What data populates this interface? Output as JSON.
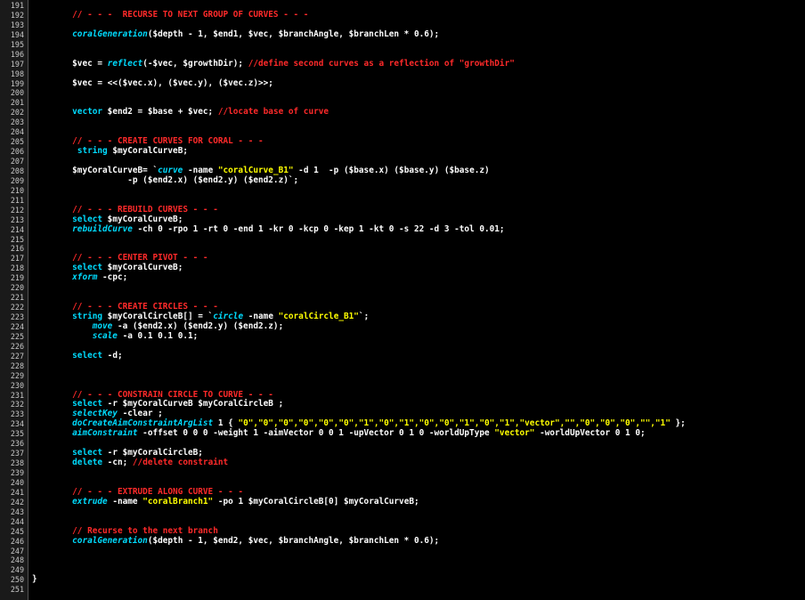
{
  "colors": {
    "background": "#000000",
    "gutter": "#1a1a1a",
    "line_number": "#c8c8c8",
    "default_text": "#ffffff",
    "comment": "#ff2a2a",
    "keyword": "#00dcff",
    "string": "#ffff00"
  },
  "editor": {
    "lines": [
      {
        "number": "191",
        "tokens": []
      },
      {
        "number": "192",
        "tokens": [
          {
            "t": "        "
          },
          {
            "c": "comment",
            "t": "// - - -  RECURSE TO NEXT GROUP OF CURVES - - -"
          }
        ]
      },
      {
        "number": "193",
        "tokens": []
      },
      {
        "number": "194",
        "tokens": [
          {
            "t": "        "
          },
          {
            "c": "func",
            "t": "coralGeneration"
          },
          {
            "t": "($depth - 1, $end1, $vec, $branchAngle, $branchLen * 0.6);"
          }
        ]
      },
      {
        "number": "195",
        "tokens": []
      },
      {
        "number": "196",
        "tokens": []
      },
      {
        "number": "197",
        "tokens": [
          {
            "t": "        $vec = "
          },
          {
            "c": "func",
            "t": "reflect"
          },
          {
            "t": "(-$vec, $growthDir); "
          },
          {
            "c": "comment",
            "t": "//define second curves as a reflection of \"growthDir\""
          }
        ]
      },
      {
        "number": "198",
        "tokens": []
      },
      {
        "number": "199",
        "tokens": [
          {
            "t": "        $vec = <<($vec.x), ($vec.y), ($vec.z)>>;"
          }
        ]
      },
      {
        "number": "200",
        "tokens": []
      },
      {
        "number": "201",
        "tokens": []
      },
      {
        "number": "202",
        "tokens": [
          {
            "t": "        "
          },
          {
            "c": "keyword",
            "t": "vector"
          },
          {
            "t": " $end2 = $base + $vec; "
          },
          {
            "c": "comment",
            "t": "//locate base of curve"
          }
        ]
      },
      {
        "number": "203",
        "tokens": []
      },
      {
        "number": "204",
        "tokens": []
      },
      {
        "number": "205",
        "tokens": [
          {
            "t": "        "
          },
          {
            "c": "comment",
            "t": "// - - - CREATE CURVES FOR CORAL - - -"
          }
        ]
      },
      {
        "number": "206",
        "tokens": [
          {
            "t": "         "
          },
          {
            "c": "keyword",
            "t": "string"
          },
          {
            "t": " $myCoralCurveB;"
          }
        ]
      },
      {
        "number": "207",
        "tokens": []
      },
      {
        "number": "208",
        "tokens": [
          {
            "t": "        $myCoralCurveB= `"
          },
          {
            "c": "func",
            "t": "curve"
          },
          {
            "t": " -name "
          },
          {
            "c": "string",
            "t": "\"coralCurve_B1\""
          },
          {
            "t": " -d 1  -p ($base.x) ($base.y) ($base.z)"
          }
        ]
      },
      {
        "number": "209",
        "tokens": [
          {
            "t": "                   -p ($end2.x) ($end2.y) ($end2.z)`;"
          }
        ]
      },
      {
        "number": "210",
        "tokens": []
      },
      {
        "number": "211",
        "tokens": []
      },
      {
        "number": "212",
        "tokens": [
          {
            "t": "        "
          },
          {
            "c": "comment",
            "t": "// - - - REBUILD CURVES - - -"
          }
        ]
      },
      {
        "number": "213",
        "tokens": [
          {
            "t": "        "
          },
          {
            "c": "keyword",
            "t": "select"
          },
          {
            "t": " $myCoralCurveB;"
          }
        ]
      },
      {
        "number": "214",
        "tokens": [
          {
            "t": "        "
          },
          {
            "c": "func",
            "t": "rebuildCurve"
          },
          {
            "t": " -ch 0 -rpo 1 -rt 0 -end 1 -kr 0 -kcp 0 -kep 1 -kt 0 -s 22 -d 3 -tol 0.01;"
          }
        ]
      },
      {
        "number": "215",
        "tokens": []
      },
      {
        "number": "216",
        "tokens": []
      },
      {
        "number": "217",
        "tokens": [
          {
            "t": "        "
          },
          {
            "c": "comment",
            "t": "// - - - CENTER PIVOT - - -"
          }
        ]
      },
      {
        "number": "218",
        "tokens": [
          {
            "t": "        "
          },
          {
            "c": "keyword",
            "t": "select"
          },
          {
            "t": " $myCoralCurveB;"
          }
        ]
      },
      {
        "number": "219",
        "tokens": [
          {
            "t": "        "
          },
          {
            "c": "func",
            "t": "xform"
          },
          {
            "t": " -cpc;"
          }
        ]
      },
      {
        "number": "220",
        "tokens": []
      },
      {
        "number": "221",
        "tokens": []
      },
      {
        "number": "222",
        "tokens": [
          {
            "t": "        "
          },
          {
            "c": "comment",
            "t": "// - - - CREATE CIRCLES - - -"
          }
        ]
      },
      {
        "number": "223",
        "tokens": [
          {
            "t": "        "
          },
          {
            "c": "keyword",
            "t": "string"
          },
          {
            "t": " $myCoralCircleB[] = `"
          },
          {
            "c": "func",
            "t": "circle"
          },
          {
            "t": " -name "
          },
          {
            "c": "string",
            "t": "\"coralCircle_B1\""
          },
          {
            "t": "`;"
          }
        ]
      },
      {
        "number": "224",
        "tokens": [
          {
            "t": "            "
          },
          {
            "c": "func",
            "t": "move"
          },
          {
            "t": " -a ($end2.x) ($end2.y) ($end2.z);"
          }
        ]
      },
      {
        "number": "225",
        "tokens": [
          {
            "t": "            "
          },
          {
            "c": "func",
            "t": "scale"
          },
          {
            "t": " -a 0.1 0.1 0.1;"
          }
        ]
      },
      {
        "number": "226",
        "tokens": []
      },
      {
        "number": "227",
        "tokens": [
          {
            "t": "        "
          },
          {
            "c": "keyword",
            "t": "select"
          },
          {
            "t": " -d;"
          }
        ]
      },
      {
        "number": "228",
        "tokens": []
      },
      {
        "number": "229",
        "tokens": []
      },
      {
        "number": "230",
        "tokens": []
      },
      {
        "number": "231",
        "tokens": [
          {
            "t": "        "
          },
          {
            "c": "comment",
            "t": "// - - - CONSTRAIN CIRCLE TO CURVE - - -"
          }
        ]
      },
      {
        "number": "232",
        "tokens": [
          {
            "t": "        "
          },
          {
            "c": "keyword",
            "t": "select"
          },
          {
            "t": " -r $myCoralCurveB $myCoralCircleB ;"
          }
        ]
      },
      {
        "number": "233",
        "tokens": [
          {
            "t": "        "
          },
          {
            "c": "func",
            "t": "selectKey"
          },
          {
            "t": " -clear ;"
          }
        ]
      },
      {
        "number": "234",
        "tokens": [
          {
            "t": "        "
          },
          {
            "c": "func",
            "t": "doCreateAimConstraintArgList"
          },
          {
            "t": " 1 { "
          },
          {
            "c": "string",
            "t": "\"0\",\"0\",\"0\",\"0\",\"0\",\"0\",\"1\",\"0\",\"1\",\"0\",\"0\",\"1\",\"0\",\"1\",\"vector\",\"\",\"0\",\"0\",\"0\",\"\",\"1\""
          },
          {
            "t": " };"
          }
        ]
      },
      {
        "number": "235",
        "tokens": [
          {
            "t": "        "
          },
          {
            "c": "func",
            "t": "aimConstraint"
          },
          {
            "t": " -offset 0 0 0 -weight 1 -aimVector 0 0 1 -upVector 0 1 0 -worldUpType "
          },
          {
            "c": "string",
            "t": "\"vector\""
          },
          {
            "t": " -worldUpVector 0 1 0;"
          }
        ]
      },
      {
        "number": "236",
        "tokens": []
      },
      {
        "number": "237",
        "tokens": [
          {
            "t": "        "
          },
          {
            "c": "keyword",
            "t": "select"
          },
          {
            "t": " -r $myCoralCircleB;"
          }
        ]
      },
      {
        "number": "238",
        "tokens": [
          {
            "t": "        "
          },
          {
            "c": "keyword",
            "t": "delete"
          },
          {
            "t": " -cn; "
          },
          {
            "c": "comment",
            "t": "//delete constraint"
          }
        ]
      },
      {
        "number": "239",
        "tokens": []
      },
      {
        "number": "240",
        "tokens": []
      },
      {
        "number": "241",
        "tokens": [
          {
            "t": "        "
          },
          {
            "c": "comment",
            "t": "// - - - EXTRUDE ALONG CURVE - - -"
          }
        ]
      },
      {
        "number": "242",
        "tokens": [
          {
            "t": "        "
          },
          {
            "c": "func",
            "t": "extrude"
          },
          {
            "t": " -name "
          },
          {
            "c": "string",
            "t": "\"coralBranch1\""
          },
          {
            "t": " -po 1 $myCoralCircleB[0] $myCoralCurveB;"
          }
        ]
      },
      {
        "number": "243",
        "tokens": []
      },
      {
        "number": "244",
        "tokens": []
      },
      {
        "number": "245",
        "tokens": [
          {
            "t": "        "
          },
          {
            "c": "comment",
            "t": "// Recurse to the next branch"
          }
        ]
      },
      {
        "number": "246",
        "tokens": [
          {
            "t": "        "
          },
          {
            "c": "func",
            "t": "coralGeneration"
          },
          {
            "t": "($depth - 1, $end2, $vec, $branchAngle, $branchLen * 0.6);"
          }
        ]
      },
      {
        "number": "247",
        "tokens": []
      },
      {
        "number": "248",
        "tokens": []
      },
      {
        "number": "249",
        "tokens": []
      },
      {
        "number": "250",
        "tokens": [
          {
            "t": "}"
          }
        ]
      },
      {
        "number": "251",
        "tokens": []
      }
    ]
  }
}
